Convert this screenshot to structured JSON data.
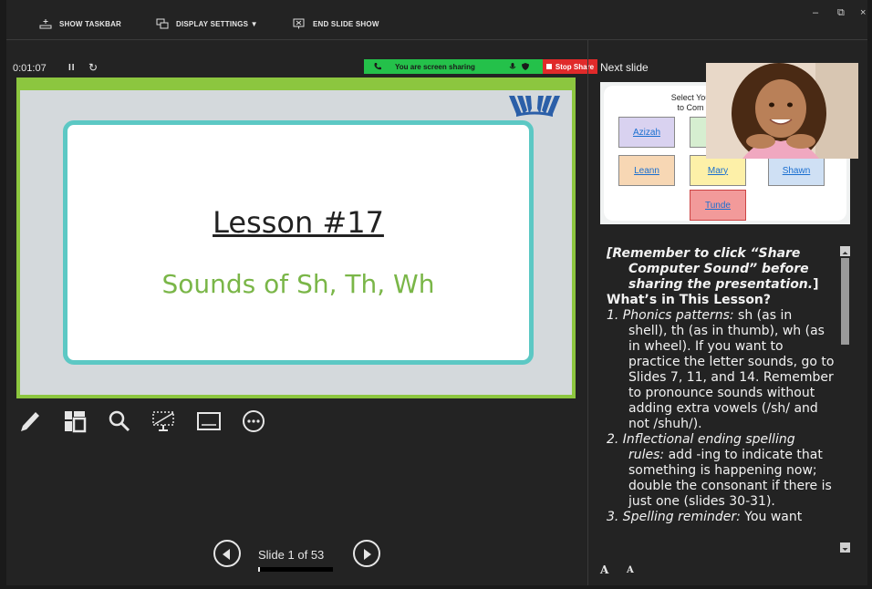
{
  "toolbar": {
    "show_taskbar": "SHOW TASKBAR",
    "display_settings": "DISPLAY SETTINGS ▼",
    "end_slide_show": "END SLIDE SHOW",
    "minimize": "–",
    "restore": "⧉",
    "close": "×"
  },
  "presenter": {
    "timer": "0:01:07",
    "pause_symbol": "II",
    "reset_symbol": "↻",
    "next_slide_label": "Next slide"
  },
  "share": {
    "banner_text": "You are screen sharing",
    "stop_label": "Stop Share"
  },
  "current_slide": {
    "title": "Lesson #17",
    "subtitle": "Sounds of Sh, Th, Wh"
  },
  "next_slide": {
    "title_line1": "Select You",
    "title_line2": "to Com",
    "names": [
      "Azizah",
      "Leann",
      "Mary",
      "Shawn",
      "Tunde"
    ]
  },
  "navigation": {
    "slide_counter": "Slide 1 of 53",
    "progress_fraction": 0.02
  },
  "notes": {
    "reminder_italic": "[Remember to click “Share Computer Sound” before sharing the presentation.",
    "reminder_close": "]",
    "heading": "What’s in This Lesson?",
    "item1_label": "1. Phonics patterns:",
    "item1_text": " sh (as in shell), th (as in thumb), wh (as in wheel). If you want to practice the letter sounds, go to Slides 7, 11, and 14. Remember to pronounce sounds without adding extra vowels (/sh/ and not /shuh/).",
    "item2_label": "2. Inflectional ending spelling rules:",
    "item2_text": " add -ing to indicate that something is happening now; double the consonant if there is just one (slides 30-31).",
    "item3_label": "3. Spelling reminder:",
    "item3_text": " You want"
  },
  "font_controls": {
    "increase": "A",
    "decrease": "A"
  },
  "colors": {
    "slide_border_green": "#8cc63f",
    "card_border_teal": "#5cc8c4",
    "subtitle_green": "#7ab648",
    "share_green": "#24c14a",
    "stop_red": "#e02a2a"
  }
}
